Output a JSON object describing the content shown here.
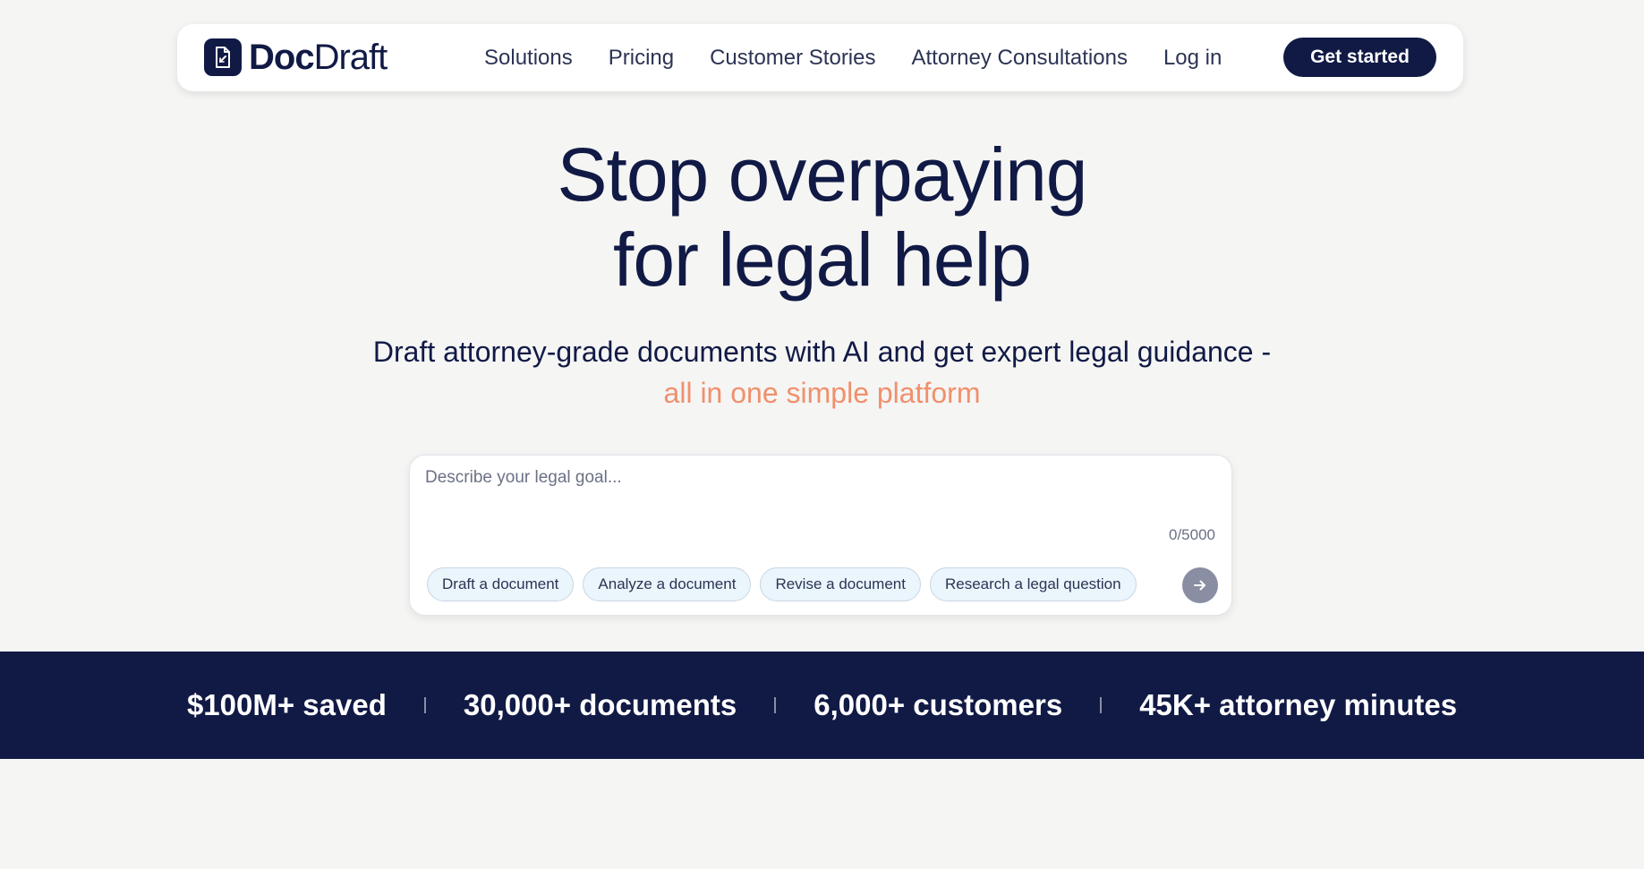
{
  "brand": {
    "name_bold": "Doc",
    "name_regular": "Draft",
    "logo_icon": "document-pen-icon",
    "navy": "#111a45",
    "accent": "#f0906c"
  },
  "nav": {
    "items": [
      {
        "label": "Solutions"
      },
      {
        "label": "Pricing"
      },
      {
        "label": "Customer Stories"
      },
      {
        "label": "Attorney Consultations"
      },
      {
        "label": "Log in"
      }
    ],
    "cta_label": "Get started"
  },
  "hero": {
    "title_line1": "Stop overpaying",
    "title_line2": "for legal help",
    "subtitle": "Draft attorney-grade documents with AI and get expert legal guidance -",
    "subtitle_accent": "all in one simple platform"
  },
  "prompt": {
    "placeholder": "Describe your legal goal...",
    "value": "",
    "counter": "0/5000",
    "chips": [
      {
        "label": "Draft a document"
      },
      {
        "label": "Analyze a document"
      },
      {
        "label": "Revise a document"
      },
      {
        "label": "Research a legal question"
      }
    ],
    "send_icon": "arrow-right-icon"
  },
  "stats": [
    {
      "label": "$100M+ saved"
    },
    {
      "label": "30,000+ documents"
    },
    {
      "label": "6,000+ customers"
    },
    {
      "label": "45K+ attorney minutes"
    }
  ]
}
